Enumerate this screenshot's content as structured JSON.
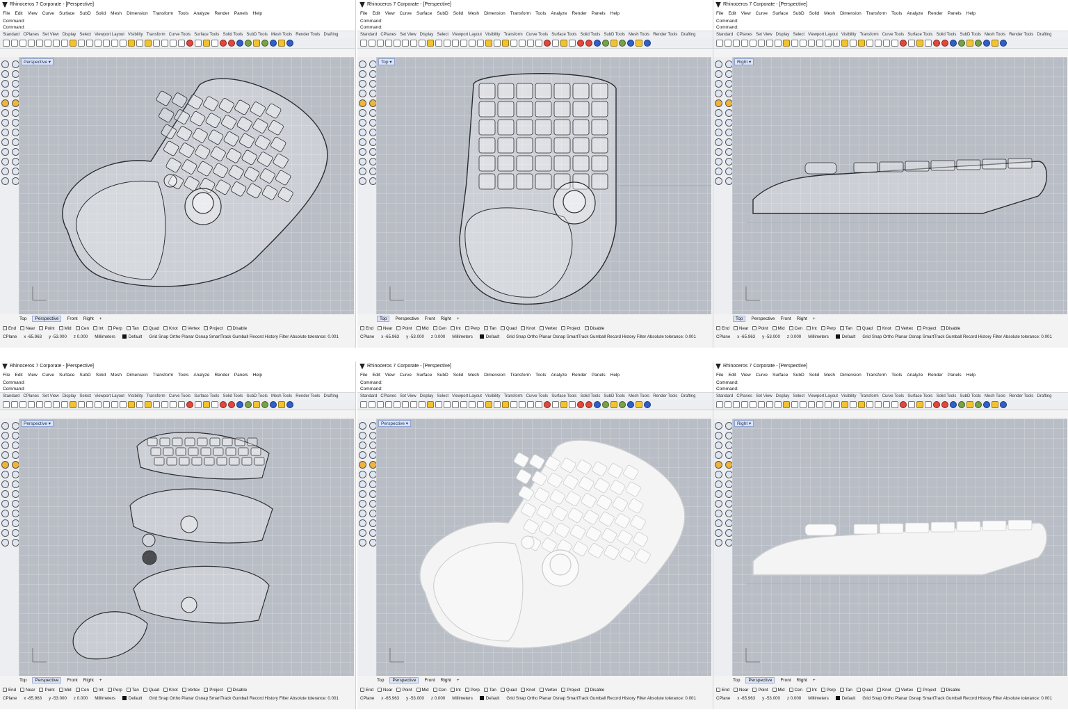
{
  "menu": [
    "File",
    "Edit",
    "View",
    "Curve",
    "Surface",
    "SubD",
    "Solid",
    "Mesh",
    "Dimension",
    "Transform",
    "Tools",
    "Analyze",
    "Render",
    "Panels",
    "Help"
  ],
  "command_history": "Command:",
  "command_prompt": "Command:",
  "toolbar_tabs": [
    "Standard",
    "CPlanes",
    "Set View",
    "Display",
    "Select",
    "Viewport Layout",
    "Visibility",
    "Transform",
    "Curve Tools",
    "Surface Tools",
    "Solid Tools",
    "SubD Tools",
    "Mesh Tools",
    "Render Tools",
    "Drafting"
  ],
  "view_tabs": [
    "Top",
    "Perspective",
    "Front",
    "Right"
  ],
  "osnaps": [
    "End",
    "Near",
    "Point",
    "Mid",
    "Cen",
    "Int",
    "Perp",
    "Tan",
    "Quad",
    "Knot",
    "Vertex",
    "Project",
    "Disable"
  ],
  "status": {
    "cplane": "CPlane",
    "x": "x -65.963",
    "y": "y -53.000",
    "z": "z 0.000",
    "units": "Millimeters",
    "layer": "Default",
    "toggles": "Grid Snap  Ortho  Planar  Osnap  SmartTrack  Gumball  Record History  Filter  Absolute tolerance: 0.001"
  },
  "windows": [
    {
      "title": "Rhinoceros 7 Corporate - [Perspective]",
      "viewport": "Perspective",
      "active_tab": "Perspective",
      "render": "wireframe",
      "view": "iso"
    },
    {
      "title": "Rhinoceros 7 Corporate - [Perspective]",
      "viewport": "Top",
      "active_tab": "Top",
      "render": "wireframe",
      "view": "top"
    },
    {
      "title": "Rhinoceros 7 Corporate - [Perspective]",
      "viewport": "Right",
      "active_tab": "Top",
      "render": "wireframe",
      "view": "side"
    },
    {
      "title": "Rhinoceros 7 Corporate - [Perspective]",
      "viewport": "Perspective",
      "active_tab": "Perspective",
      "render": "wireframe",
      "view": "exploded"
    },
    {
      "title": "Rhinoceros 7 Corporate - [Perspective]",
      "viewport": "Perspective",
      "active_tab": "Perspective",
      "render": "shaded",
      "view": "iso"
    },
    {
      "title": "Rhinoceros 7 Corporate - [Perspective]",
      "viewport": "Right",
      "active_tab": "Perspective",
      "render": "shaded",
      "view": "side"
    }
  ],
  "colors": {
    "viewport_bg": "#b9bec6",
    "wire": "#2b2d31",
    "shaded": "#f4f4f4"
  }
}
